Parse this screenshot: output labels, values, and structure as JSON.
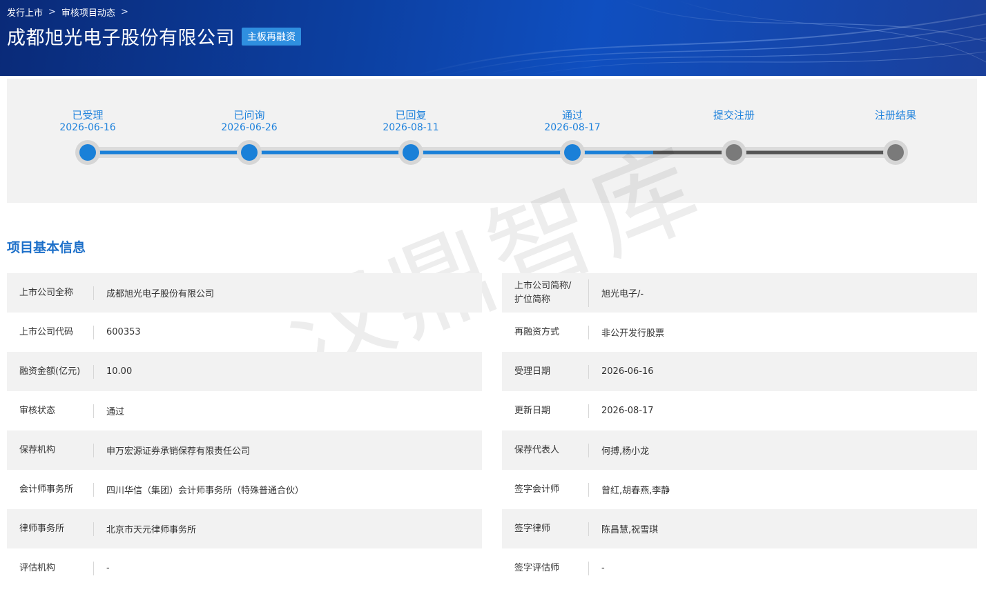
{
  "breadcrumb": {
    "items": [
      "发行上市",
      "审核项目动态"
    ],
    "separator": ">"
  },
  "header": {
    "company": "成都旭光电子股份有限公司",
    "badge": "主板再融资"
  },
  "progress": {
    "colors": {
      "done": "#1a80d8",
      "pending": "#7a7a7a"
    },
    "steps": [
      {
        "label": "已受理",
        "date": "2026-06-16",
        "done": true
      },
      {
        "label": "已问询",
        "date": "2026-06-26",
        "done": true
      },
      {
        "label": "已回复",
        "date": "2026-08-11",
        "done": true
      },
      {
        "label": "通过",
        "date": "2026-08-17",
        "done": true
      },
      {
        "label": "提交注册",
        "date": "",
        "done": false
      },
      {
        "label": "注册结果",
        "date": "",
        "done": false
      }
    ]
  },
  "section": {
    "title": "项目基本信息"
  },
  "watermark": "汉鼎智库",
  "info": {
    "left": [
      {
        "label": "上市公司全称",
        "value": "成都旭光电子股份有限公司"
      },
      {
        "label": "上市公司代码",
        "value": "600353"
      },
      {
        "label": "融资金额(亿元)",
        "value": "10.00"
      },
      {
        "label": "审核状态",
        "value": "通过"
      },
      {
        "label": "保荐机构",
        "value": "申万宏源证券承销保荐有限责任公司"
      },
      {
        "label": "会计师事务所",
        "value": "四川华信（集团）会计师事务所（特殊普通合伙）"
      },
      {
        "label": "律师事务所",
        "value": "北京市天元律师事务所"
      },
      {
        "label": "评估机构",
        "value": "-"
      }
    ],
    "right": [
      {
        "label_line1": "上市公司简称/",
        "label_line2": "扩位简称",
        "value": "旭光电子/-"
      },
      {
        "label": "再融资方式",
        "value": "非公开发行股票"
      },
      {
        "label": "受理日期",
        "value": "2026-06-16"
      },
      {
        "label": "更新日期",
        "value": "2026-08-17"
      },
      {
        "label": "保荐代表人",
        "value": "何搏,杨小龙"
      },
      {
        "label": "签字会计师",
        "value": "曾红,胡春燕,李静"
      },
      {
        "label": "签字律师",
        "value": "陈昌慧,祝雪琪"
      },
      {
        "label": "签字评估师",
        "value": "-"
      }
    ]
  }
}
